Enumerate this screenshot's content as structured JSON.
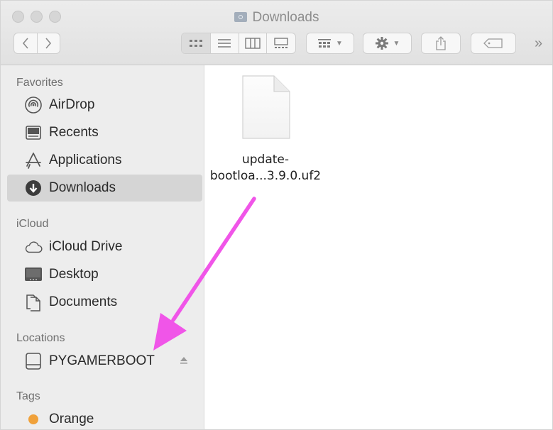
{
  "window": {
    "title": "Downloads"
  },
  "toolbar": {
    "back": "‹",
    "forward": "›",
    "overflow": "»"
  },
  "sidebar": {
    "favorites_header": "Favorites",
    "icloud_header": "iCloud",
    "locations_header": "Locations",
    "tags_header": "Tags",
    "favorites": [
      {
        "label": "AirDrop",
        "icon": "airdrop-icon"
      },
      {
        "label": "Recents",
        "icon": "recents-icon"
      },
      {
        "label": "Applications",
        "icon": "applications-icon"
      },
      {
        "label": "Downloads",
        "icon": "downloads-icon",
        "selected": true
      }
    ],
    "icloud": [
      {
        "label": "iCloud Drive",
        "icon": "cloud-icon"
      },
      {
        "label": "Desktop",
        "icon": "desktop-icon"
      },
      {
        "label": "Documents",
        "icon": "documents-icon"
      }
    ],
    "locations": [
      {
        "label": "PYGAMERBOOT",
        "icon": "drive-icon",
        "ejectable": true
      }
    ],
    "tags": [
      {
        "label": "Orange",
        "color": "#f0a13a"
      }
    ]
  },
  "content": {
    "files": [
      {
        "name_line1": "update-",
        "name_line2": "bootloa...3.9.0.uf2",
        "icon": "file-icon"
      }
    ]
  },
  "colors": {
    "annotation_arrow": "#f055e8",
    "selection": "#d5d5d5",
    "tag_orange": "#f0a13a"
  }
}
